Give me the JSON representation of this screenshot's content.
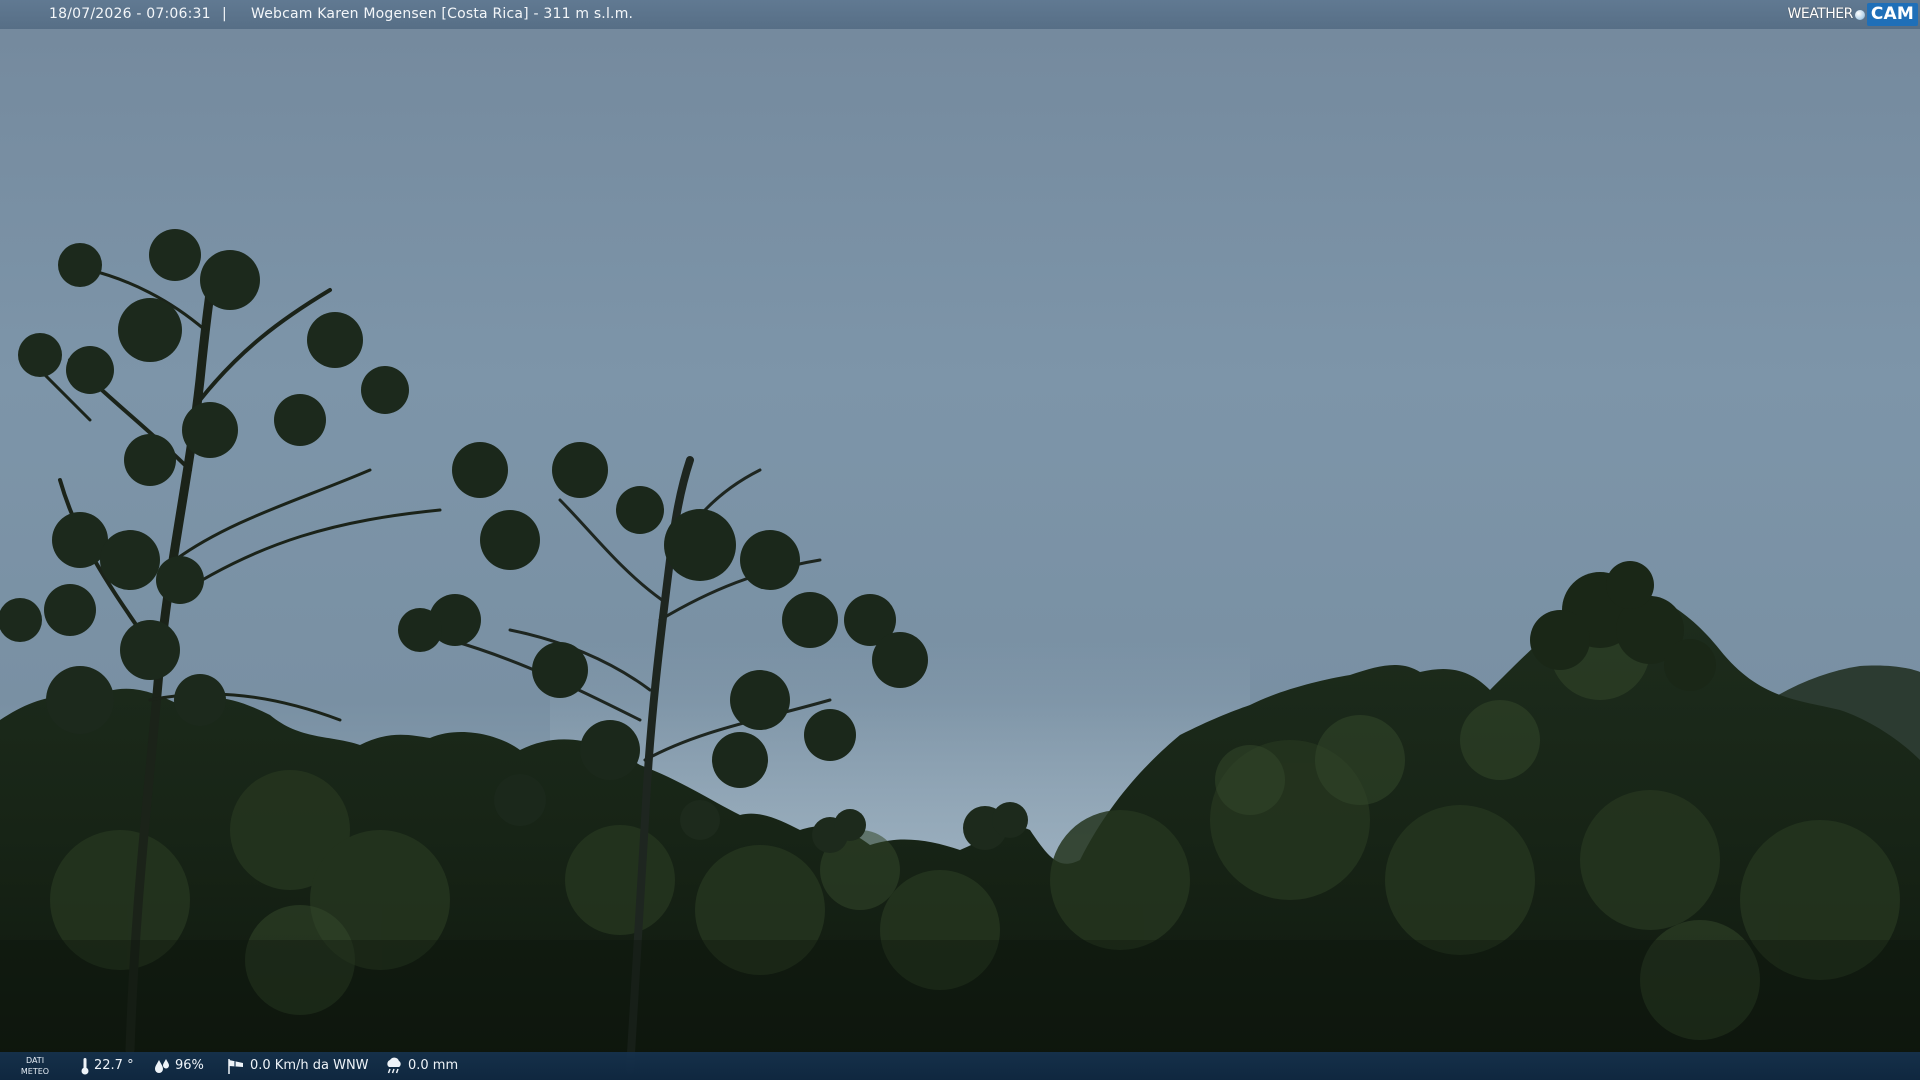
{
  "header": {
    "datetime": "18/07/2026 - 07:06:31",
    "separator": "|",
    "caption": "Webcam Karen Mogensen [Costa Rica]  - 311 m s.l.m.",
    "logo_weather": "WEATHER",
    "logo_cam": "CAM"
  },
  "weather": {
    "badge_line1": "DATI",
    "badge_line2": "METEO",
    "temperature": "22.7 °",
    "humidity": "96%",
    "wind": "0.0 Km/h da WNW",
    "rain": "0.0 mm",
    "icons": [
      "thermometer-icon",
      "humidity-drops-icon",
      "wind-sock-icon",
      "rain-cloud-icon"
    ]
  },
  "colors": {
    "sky_top": "#7b93a9",
    "sky_mid": "#7f98ac",
    "sky_low": "#93a9b9",
    "foliage_dark": "#10180f",
    "foliage_mid": "#1c2a1a",
    "foliage_light": "#2a3a25",
    "bar_top": "#5f7891",
    "bar_bottom": "#16324e",
    "logo_blue": "#1f6fb8"
  }
}
